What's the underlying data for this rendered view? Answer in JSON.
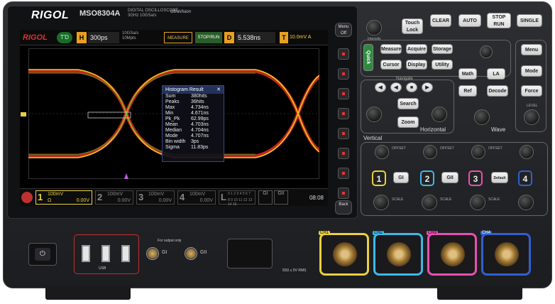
{
  "brand": {
    "logo": "RIGOL",
    "model": "MSO8304A",
    "model_sub_1": "DIGITAL OSCILLOSCOPE",
    "model_sub_2": "3GHz 10GSa/s",
    "ultra": "UltraVision"
  },
  "screen": {
    "topbar": {
      "logo": "RIGOL",
      "mode_badge": "T'D",
      "h_label": "H",
      "h_value": "300ps",
      "sample_rate": "10GSa/s",
      "mem_depth": "10Mpts",
      "measure_label": "MEASURE",
      "stop_run_label": "STOP/RUN",
      "d_label": "D",
      "d_value": "5.538ns",
      "t_label": "T",
      "t_value": "10.0mV",
      "t_channel": "A"
    },
    "histogram": {
      "title": "Histogram Result",
      "close": "✕",
      "rows": [
        {
          "k": "Sum",
          "v": "380hits"
        },
        {
          "k": "Peaks",
          "v": "36hits"
        },
        {
          "k": "Max",
          "v": "4.734ns"
        },
        {
          "k": "Min",
          "v": "4.671ns"
        },
        {
          "k": "Pk_Pk",
          "v": "62.99ps"
        },
        {
          "k": "Mean",
          "v": "4.703ns"
        },
        {
          "k": "Median",
          "v": "4.704ns"
        },
        {
          "k": "Mode",
          "v": "4.707ns"
        },
        {
          "k": "Bin width",
          "v": "3ps"
        },
        {
          "k": "Sigma",
          "v": "11.83ps"
        }
      ]
    },
    "channels": [
      {
        "num": "1",
        "scale": "100mV",
        "offset": "0.00V",
        "coupling": "Ω"
      },
      {
        "num": "2",
        "scale": "100mV",
        "offset": "0.00V"
      },
      {
        "num": "3",
        "scale": "100mV",
        "offset": "0.00V"
      },
      {
        "num": "4",
        "scale": "100mV",
        "offset": "0.00V"
      }
    ],
    "logic": {
      "label": "L",
      "bits_top": "0 1 2 3 4 5 6 7",
      "bits_bottom": "8 9 10 11 12 13 14 15"
    },
    "g1": "GI",
    "g2": "GII",
    "clock": "08:08"
  },
  "side": {
    "menu_off": "Menu Off",
    "back": "Back"
  },
  "panel": {
    "intensity": "Intensity",
    "touch_lock": "Touch Lock",
    "clear": "CLEAR",
    "auto": "AUTO",
    "stop_run": "STOP RUN",
    "single": "SINGLE",
    "quick": "Quick",
    "keys": [
      "Measure",
      "Acquire",
      "Storage",
      "Cursor",
      "Display",
      "Utility"
    ],
    "math": "Math",
    "la": "LA",
    "ref": "Ref",
    "decode": "Decode",
    "trig_menu": "Menu",
    "trig_mode": "Mode",
    "trig_force": "Force",
    "navigate": "Navigate",
    "search": "Search",
    "zoom": "Zoom",
    "horizontal": "Horizontal",
    "position": "POSITION",
    "scale": "SCALE",
    "level": "LEVEL",
    "wave": "Wave",
    "vertical": "Vertical",
    "offset": "OFFSET",
    "ch_keys": [
      "1",
      "GI",
      "2",
      "GII",
      "3",
      "Default",
      "4"
    ],
    "colors": {
      "ch1": "#e8d040",
      "ch2": "#40b8e8",
      "ch3": "#e850b0",
      "ch4": "#3060d0"
    }
  },
  "lower": {
    "power": "⏻",
    "g1": "GI",
    "g2": "GII",
    "cal_note": "For output only",
    "chports": [
      "CH1",
      "CH2",
      "CH3",
      "CH4"
    ],
    "port_spec": "50Ω ≤ 5V RMS",
    "usb_icon": "USB"
  }
}
